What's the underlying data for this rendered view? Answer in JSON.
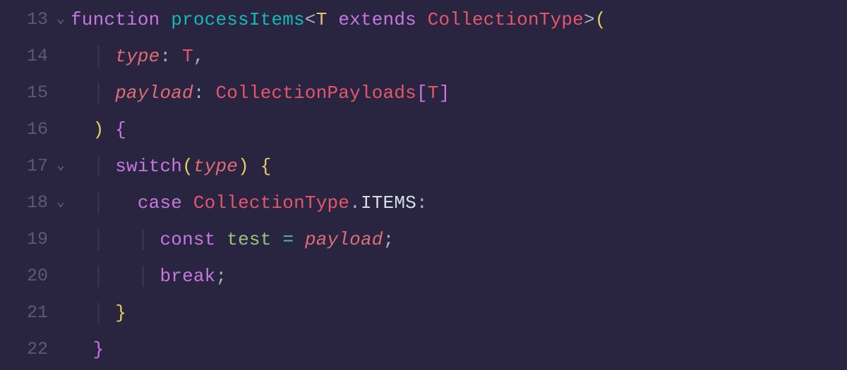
{
  "editor": {
    "lines": [
      {
        "num": "13",
        "fold": "⌄"
      },
      {
        "num": "14",
        "fold": ""
      },
      {
        "num": "15",
        "fold": ""
      },
      {
        "num": "16",
        "fold": ""
      },
      {
        "num": "17",
        "fold": "⌄"
      },
      {
        "num": "18",
        "fold": "⌄"
      },
      {
        "num": "19",
        "fold": ""
      },
      {
        "num": "20",
        "fold": ""
      },
      {
        "num": "21",
        "fold": ""
      },
      {
        "num": "22",
        "fold": ""
      }
    ],
    "tokens": {
      "kw_function": "function",
      "fn_processItems": "processItems",
      "lt": "<",
      "generic_T": "T",
      "kw_extends": "extends",
      "type_CollectionType": "CollectionType",
      "gt": ">",
      "paren_open": "(",
      "param_type": "type",
      "colon": ":",
      "space": " ",
      "T_ref": "T",
      "comma": ",",
      "param_payload": "payload",
      "type_CollectionPayloads": "CollectionPayloads",
      "bracket_open": "[",
      "bracket_close": "]",
      "paren_close": ")",
      "brace_open": "{",
      "kw_switch": "switch",
      "kw_case": "case",
      "dot": ".",
      "prop_ITEMS": "ITEMS",
      "kw_const": "const",
      "var_test": "test",
      "op_eq": "=",
      "ident_payload": "payload",
      "semicolon": ";",
      "kw_break": "break",
      "brace_close": "}",
      "indent_pipe": "│"
    }
  }
}
